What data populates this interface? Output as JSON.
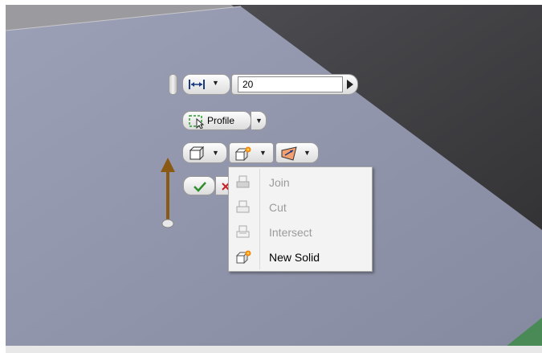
{
  "toolbar": {
    "distance_value": "20",
    "profile_label": "Profile"
  },
  "menu": {
    "items": [
      {
        "label": "Join",
        "enabled": false,
        "icon": "join-icon"
      },
      {
        "label": "Cut",
        "enabled": false,
        "icon": "cut-icon"
      },
      {
        "label": "Intersect",
        "enabled": false,
        "icon": "intersect-icon"
      },
      {
        "label": "New Solid",
        "enabled": true,
        "icon": "new-solid-icon"
      }
    ]
  },
  "colors": {
    "plane": "#8c91a6",
    "dark_bg": "#3b3b3d",
    "ok_green": "#2f8f2f",
    "arrow_brown": "#8a5a14"
  }
}
